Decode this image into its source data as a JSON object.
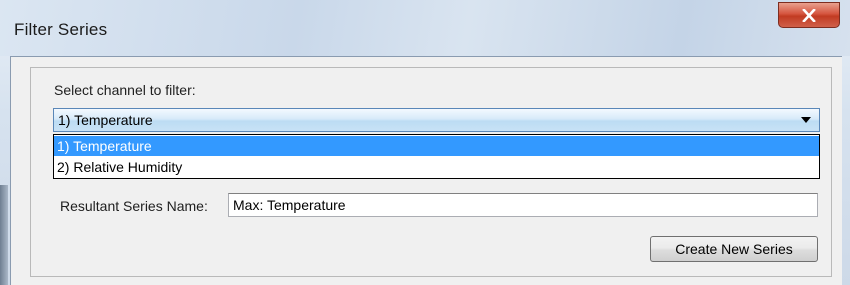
{
  "window": {
    "title": "Filter Series",
    "close_icon": "close-x-icon"
  },
  "filter": {
    "channel_label": "Select channel to filter:",
    "selected_channel": "1) Temperature",
    "options": [
      "1) Temperature",
      "2) Relative Humidity"
    ],
    "dropdown_icon": "chevron-down-icon"
  },
  "result": {
    "name_label": "Resultant Series Name:",
    "name_value": "Max: Temperature"
  },
  "actions": {
    "create_label": "Create New Series"
  },
  "colors": {
    "selection": "#3399ff",
    "close_button": "#c94a35"
  }
}
